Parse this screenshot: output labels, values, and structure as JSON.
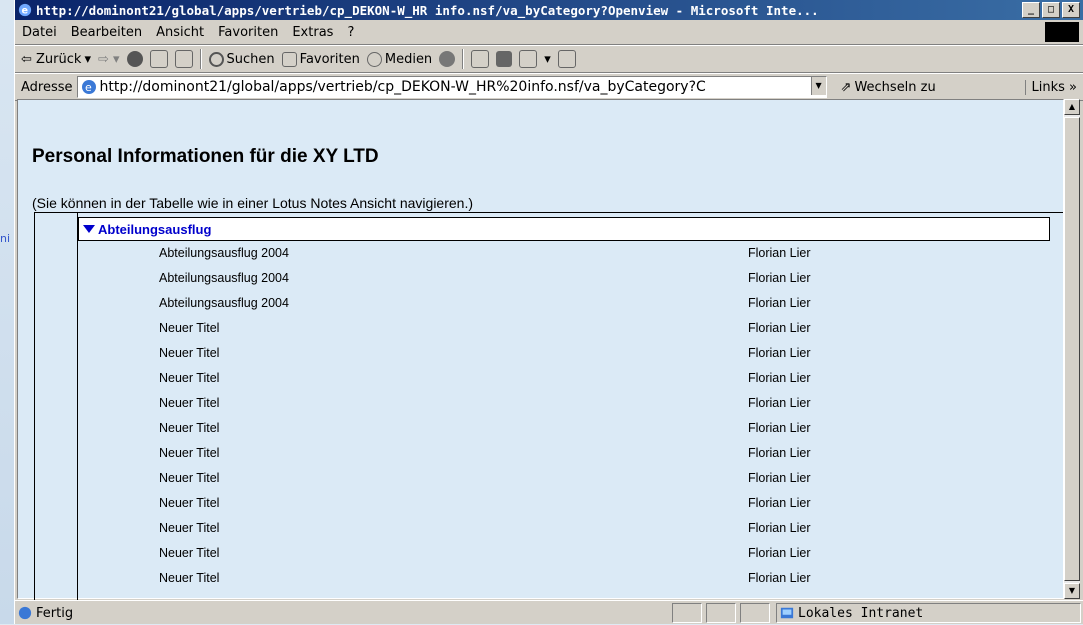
{
  "background": {
    "partial_text": "ni"
  },
  "window": {
    "title": "http://dominont21/global/apps/vertrieb/cp_DEKON-W_HR info.nsf/va_byCategory?Openview - Microsoft Inte...",
    "minimize": "_",
    "maximize": "□",
    "close": "X"
  },
  "menu": [
    "Datei",
    "Bearbeiten",
    "Ansicht",
    "Favoriten",
    "Extras",
    "?"
  ],
  "toolbar": {
    "back": "⇦ Zurück",
    "search": "Suchen",
    "favorites": "Favoriten",
    "media": "Medien"
  },
  "address": {
    "label": "Adresse",
    "url": "http://dominont21/global/apps/vertrieb/cp_DEKON-W_HR%20info.nsf/va_byCategory?C",
    "go": "Wechseln zu",
    "links": "Links »"
  },
  "page": {
    "title": "Personal Informationen für die XY LTD",
    "hint": "(Sie können in der Tabelle wie in einer Lotus Notes Ansicht navigieren.)",
    "category": "Abteilungsausflug",
    "rows": [
      {
        "title": "Abteilungsausflug 2004",
        "author": "Florian Lier"
      },
      {
        "title": "Abteilungsausflug 2004",
        "author": "Florian Lier"
      },
      {
        "title": "Abteilungsausflug 2004",
        "author": "Florian Lier"
      },
      {
        "title": "Neuer Titel",
        "author": "Florian Lier"
      },
      {
        "title": "Neuer Titel",
        "author": "Florian Lier"
      },
      {
        "title": "Neuer Titel",
        "author": "Florian Lier"
      },
      {
        "title": "Neuer Titel",
        "author": "Florian Lier"
      },
      {
        "title": "Neuer Titel",
        "author": "Florian Lier"
      },
      {
        "title": "Neuer Titel",
        "author": "Florian Lier"
      },
      {
        "title": "Neuer Titel",
        "author": "Florian Lier"
      },
      {
        "title": "Neuer Titel",
        "author": "Florian Lier"
      },
      {
        "title": "Neuer Titel",
        "author": "Florian Lier"
      },
      {
        "title": "Neuer Titel",
        "author": "Florian Lier"
      },
      {
        "title": "Neuer Titel",
        "author": "Florian Lier"
      }
    ]
  },
  "status": {
    "text": "Fertig",
    "zone": "Lokales Intranet"
  },
  "colors": {
    "title_bar": "#0a246a",
    "content_bg": "#dbeaf6",
    "category_text": "#0000cc"
  }
}
